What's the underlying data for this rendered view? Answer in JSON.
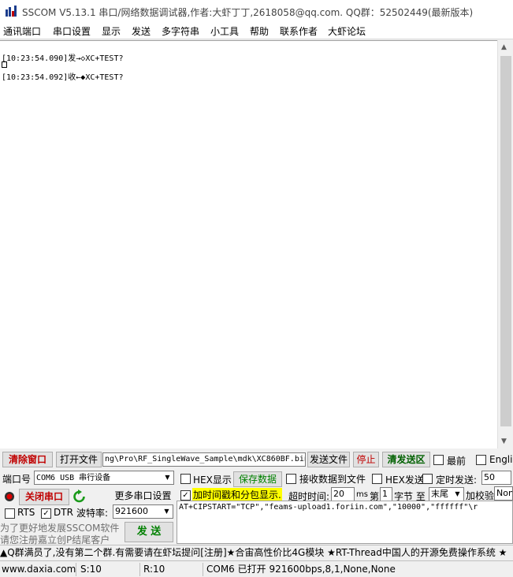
{
  "window": {
    "title": "SSCOM V5.13.1 串口/网络数据调试器,作者:大虾丁丁,2618058@qq.com. QQ群：52502449(最新版本)"
  },
  "menu": [
    "通讯端口",
    "串口设置",
    "显示",
    "发送",
    "多字符串",
    "小工具",
    "帮助",
    "联系作者",
    "大虾论坛"
  ],
  "receive": {
    "lines": [
      {
        "text": "[10:23:54.090]发→◇XC+TEST?"
      },
      {
        "text": ""
      },
      {
        "text": "[10:23:54.092]收←◆XC+TEST?"
      }
    ]
  },
  "toolbar1": {
    "clear_window": "清除窗口",
    "open_file": "打开文件",
    "file_path": "ng\\Pro\\RF_SingleWave_Sample\\mdk\\XC860BF.bin",
    "send_file": "发送文件",
    "stop": "停止",
    "clear_send": "清发送区",
    "topmost": "最前",
    "english": "English"
  },
  "port_row": {
    "port_label": "端口号",
    "port_value": "COM6 USB 串行设备",
    "hex_display": "HEX显示",
    "save_data": "保存数据",
    "recv_to_file": "接收数据到文件",
    "hex_send": "HEX发送",
    "timed_send": "定时发送:",
    "interval": "50"
  },
  "port_row2": {
    "close_port": "关闭串口",
    "more_settings": "更多串口设置",
    "timestamp": "加时间戳和分包显示.",
    "timeout_label": "超时时间:",
    "timeout_value": "20",
    "ms": "ms",
    "nth_label": "第",
    "nth_value": "1",
    "byte_label": "字节 至",
    "end_value": "末尾",
    "checksum_label": "加校验",
    "checksum_value": "None"
  },
  "port_row3": {
    "rts": "RTS",
    "dtr": "DTR",
    "baud_label": "波特率:",
    "baud_value": "921600"
  },
  "send": {
    "text": "AT+CIPSTART=\"TCP\",\"feams-upload1.foriin.com\",\"10000\",\"ffffff\"\\r",
    "button": "发 送",
    "notice_line1": "为了更好地发展SSCOM软件",
    "notice_line2": "请您注册嘉立创P结尾客户"
  },
  "adbar": "▲Q群满员了,没有第二个群.有需要请在虾坛提问[注册]★合宙高性价比4G模块 ★RT-Thread中国人的开源免费操作系统 ★",
  "status": {
    "website": "www.daxia.com",
    "sent": "S:10",
    "received": "R:10",
    "port_info": "COM6 已打开  921600bps,8,1,None,None"
  },
  "colors": {
    "accent_red": "#c00000",
    "accent_green": "#008000",
    "highlight_yellow": "#ffff00"
  }
}
